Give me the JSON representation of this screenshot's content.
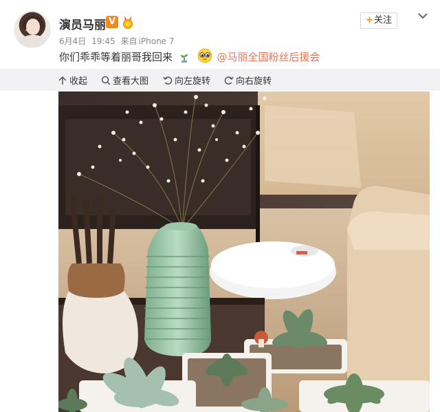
{
  "header": {
    "username": "演员马丽",
    "verified_badge": "V",
    "date": "6月4日",
    "time": "19:45",
    "source_prefix": "来自",
    "source": "iPhone 7",
    "follow_label": "关注",
    "follow_plus": "+"
  },
  "post": {
    "text": "你们乖乖等着丽哥我回来",
    "mention": "@马丽全国粉丝后援会"
  },
  "toolbar": {
    "collapse_label": "收起",
    "zoom_label": "查看大图",
    "rotate_left_label": "向左旋转",
    "rotate_right_label": "向右旋转"
  },
  "colors": {
    "accent": "#ff8200",
    "mention": "#eb7350",
    "toolbar_bg": "#f2f2f5",
    "verified": "#f28a1c"
  },
  "icons": [
    "verified-icon",
    "medal-icon",
    "chevron-down-icon",
    "collapse-icon",
    "zoom-icon",
    "rotate-left-icon",
    "rotate-right-icon",
    "small-plant-emoji-icon",
    "pleading-face-emoji-icon"
  ]
}
